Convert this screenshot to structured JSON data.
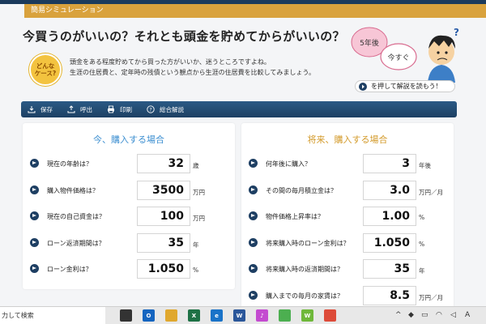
{
  "header": {
    "tab_label": "簡易シミュレーション"
  },
  "page": {
    "title": "今買うのがいいの？それとも頭金を貯めてからがいいの？",
    "badge_text": "どんな\nケース?",
    "description_line1": "頭金をある程度貯めてから買った方がいいか、迷うところですよね。",
    "description_line2": "生涯の住居費と、定年時の残債という観点から生涯の住居費を比較してみましょう。",
    "illustration_bubble1": "5年後",
    "illustration_bubble2": "今すぐ",
    "illustration_bubble3": "?",
    "explain_button": "を押して解説を読もう！"
  },
  "toolbar": {
    "items": [
      {
        "label": "保存",
        "icon": "download-icon"
      },
      {
        "label": "呼出",
        "icon": "upload-icon"
      },
      {
        "label": "印刷",
        "icon": "print-icon"
      },
      {
        "label": "総合解説",
        "icon": "help-icon"
      }
    ]
  },
  "left_panel": {
    "title": "今、購入する場合",
    "rows": [
      {
        "label": "現在の年齢は？",
        "value": "32",
        "unit": "歳"
      },
      {
        "label": "購入物件価格は？",
        "value": "3500",
        "unit": "万円"
      },
      {
        "label": "現在の自己資金は？",
        "value": "100",
        "unit": "万円"
      },
      {
        "label": "ローン返済期間は？",
        "value": "35",
        "unit": "年"
      },
      {
        "label": "ローン金利は？",
        "value": "1.050",
        "unit": "%"
      }
    ]
  },
  "right_panel": {
    "title": "将来、購入する場合",
    "rows": [
      {
        "label": "何年後に購入？",
        "value": "3",
        "unit": "年後"
      },
      {
        "label": "その間の毎月積立金は？",
        "value": "3.0",
        "unit": "万円／月"
      },
      {
        "label": "物件価格上昇率は？",
        "value": "1.00",
        "unit": "%"
      },
      {
        "label": "将来購入時のローン金利は？",
        "value": "1.050",
        "unit": "%"
      },
      {
        "label": "将来購入時の返済期間は？",
        "value": "35",
        "unit": "年"
      },
      {
        "label": "購入までの毎月の家賃は？",
        "value": "8.5",
        "unit": "万円／月"
      }
    ]
  },
  "taskbar": {
    "search_text": "力して検索",
    "apps": [
      {
        "icon": "task-view-icon",
        "color": "#333333",
        "glyph": ""
      },
      {
        "icon": "outlook-icon",
        "color": "#1565c0",
        "glyph": "O"
      },
      {
        "icon": "folder-icon",
        "color": "#e0a82e",
        "glyph": ""
      },
      {
        "icon": "excel-icon",
        "color": "#1e7145",
        "glyph": "X"
      },
      {
        "icon": "edge-icon",
        "color": "#1a73c8",
        "glyph": "e"
      },
      {
        "icon": "word-icon",
        "color": "#2b579a",
        "glyph": "W"
      },
      {
        "icon": "itunes-icon",
        "color": "#c44bd0",
        "glyph": "♪"
      },
      {
        "icon": "maps-icon",
        "color": "#4caf50",
        "glyph": ""
      },
      {
        "icon": "wsim-icon",
        "color": "#6fb83a",
        "glyph": "W"
      },
      {
        "icon": "chrome-icon",
        "color": "#dd4b39",
        "glyph": ""
      }
    ]
  }
}
